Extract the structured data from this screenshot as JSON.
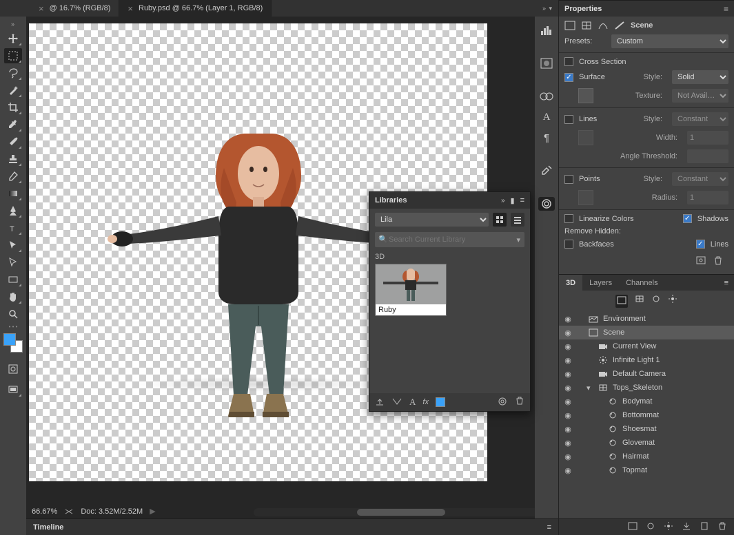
{
  "tabs": [
    {
      "label": "@ 16.7% (RGB/8)",
      "active": false
    },
    {
      "label": "Ruby.psd @ 66.7% (Layer 1, RGB/8)",
      "active": true
    }
  ],
  "status": {
    "zoom": "66.67%",
    "doc": "Doc: 3.52M/2.52M"
  },
  "timeline": {
    "title": "Timeline"
  },
  "libraries": {
    "title": "Libraries",
    "list": "Lila",
    "search_placeholder": "Search Current Library",
    "section": "3D",
    "item": "Ruby"
  },
  "properties": {
    "title": "Properties",
    "scene_label": "Scene",
    "presets_label": "Presets:",
    "preset_value": "Custom",
    "cross_section": {
      "label": "Cross Section",
      "on": false
    },
    "surface": {
      "label": "Surface",
      "on": true,
      "style_label": "Style:",
      "style": "Solid",
      "texture_label": "Texture:",
      "texture": "Not Avail…"
    },
    "lines": {
      "label": "Lines",
      "on": false,
      "style_label": "Style:",
      "style": "Constant",
      "width_label": "Width:",
      "width": "1",
      "angle_label": "Angle Threshold:"
    },
    "points": {
      "label": "Points",
      "on": false,
      "style_label": "Style:",
      "style": "Constant",
      "radius_label": "Radius:",
      "radius": "1"
    },
    "linearize": {
      "label": "Linearize Colors",
      "on": false
    },
    "shadows": {
      "label": "Shadows",
      "on": true
    },
    "remove_hidden": "Remove Hidden:",
    "backfaces": {
      "label": "Backfaces",
      "on": false
    },
    "lines2": {
      "label": "Lines",
      "on": true
    }
  },
  "panel_tabs": [
    "3D",
    "Layers",
    "Channels"
  ],
  "tree": [
    {
      "depth": 0,
      "icon": "env",
      "label": "Environment"
    },
    {
      "depth": 0,
      "icon": "scene",
      "label": "Scene",
      "sel": true
    },
    {
      "depth": 1,
      "icon": "cam",
      "label": "Current View"
    },
    {
      "depth": 1,
      "icon": "light",
      "label": "Infinite Light 1"
    },
    {
      "depth": 1,
      "icon": "cam",
      "label": "Default Camera"
    },
    {
      "depth": 1,
      "icon": "mesh",
      "label": "Tops_Skeleton",
      "tw": "v"
    },
    {
      "depth": 2,
      "icon": "mat",
      "label": "Bodymat"
    },
    {
      "depth": 2,
      "icon": "mat",
      "label": "Bottommat"
    },
    {
      "depth": 2,
      "icon": "mat",
      "label": "Shoesmat"
    },
    {
      "depth": 2,
      "icon": "mat",
      "label": "Glovemat"
    },
    {
      "depth": 2,
      "icon": "mat",
      "label": "Hairmat"
    },
    {
      "depth": 2,
      "icon": "mat",
      "label": "Topmat"
    }
  ]
}
